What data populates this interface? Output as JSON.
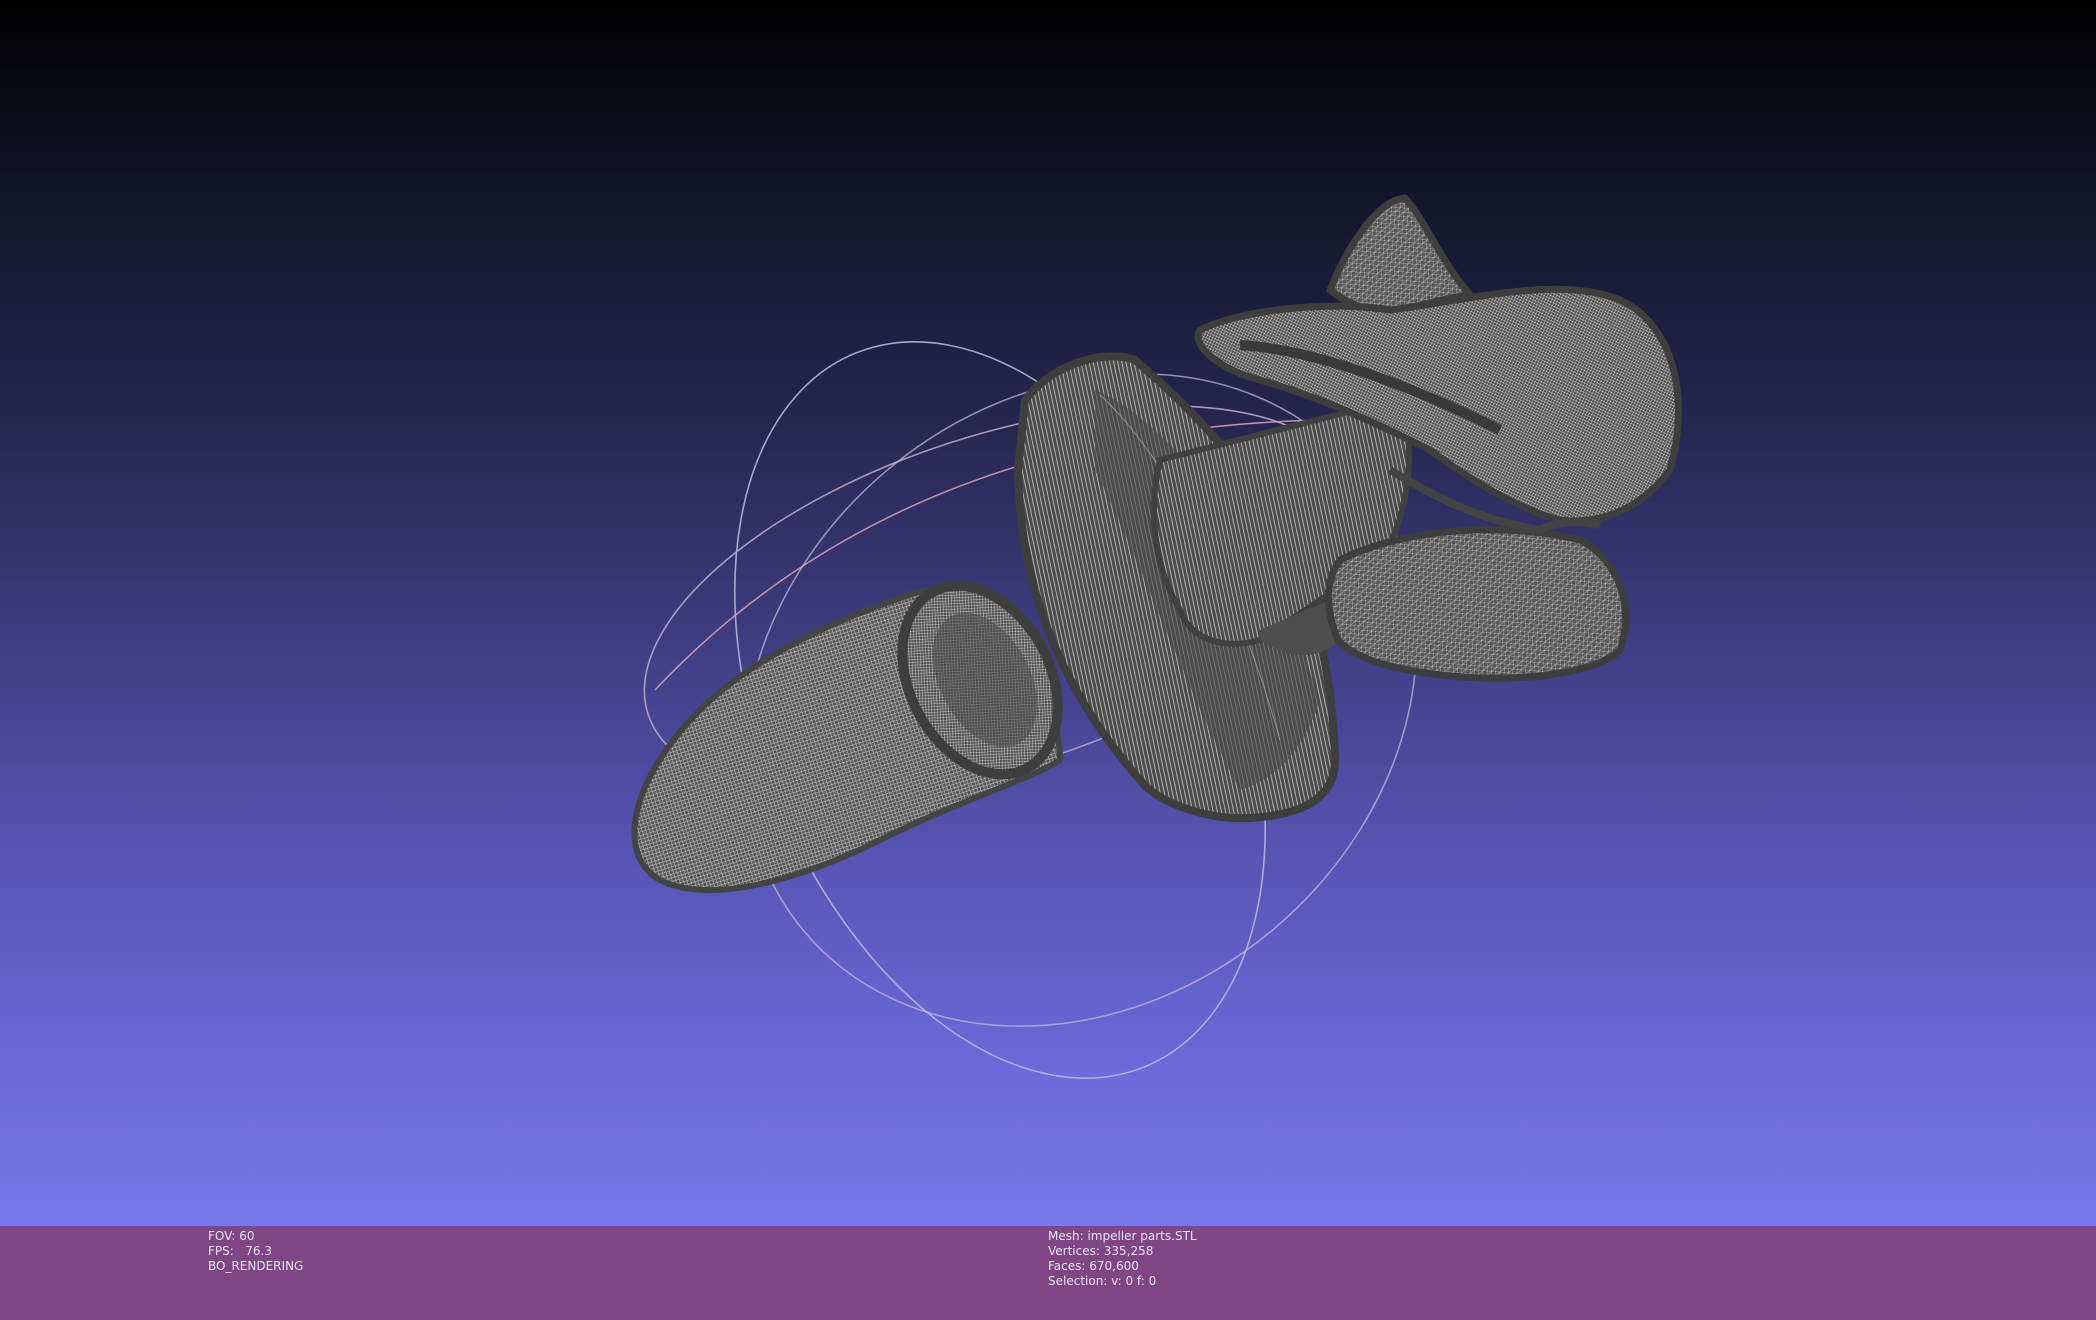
{
  "viewer": {
    "background_colors": [
      "#000000",
      "#25244c",
      "#5451ad",
      "#7777ec"
    ],
    "infobar_color": "#7f4584"
  },
  "scene": {
    "mesh_color": "#5a5a5a",
    "wire_color": "#d8d8d8",
    "trackball_colors": [
      "#b9b2dc",
      "#b7a6c8",
      "#d7a3b8"
    ]
  },
  "status": {
    "left": {
      "fov": "FOV: 60",
      "fps": "FPS:   76.3",
      "mode": "BO_RENDERING"
    },
    "right": {
      "mesh": "Mesh: impeller parts.STL",
      "vertices": "Vertices: 335,258",
      "faces": "Faces: 670,600",
      "selection": "Selection: v: 0 f: 0"
    }
  }
}
